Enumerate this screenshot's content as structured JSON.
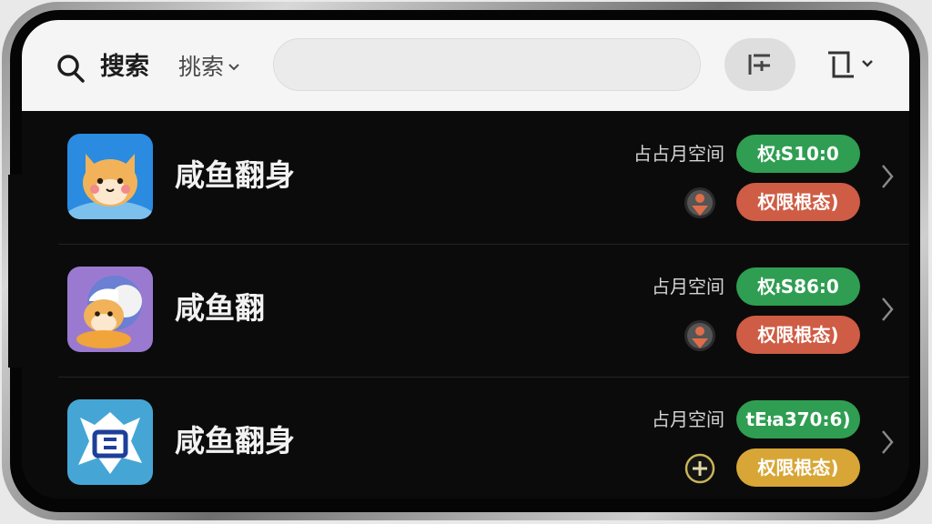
{
  "header": {
    "search_label": "搜索",
    "scope_label": "挑索",
    "search_placeholder": "",
    "search_value": "",
    "icons": {
      "search": "search-icon",
      "scope_dropdown": "chevron-down-icon",
      "filter": "filter-icon",
      "action": "crop-icon",
      "action_dropdown": "chevron-down-icon"
    }
  },
  "apps": [
    {
      "name": "咸鱼翻身",
      "space_label": "占占月空间",
      "primary_badge": "权ᵼS10:0",
      "secondary_badge": "权限根态)",
      "status_icon": "person-marker-icon",
      "icon": "fox-avatar-icon",
      "icon_bg": "#2a8be0",
      "secondary_color": "#cf5c44"
    },
    {
      "name": "咸鱼翻",
      "space_label": "占月空间",
      "primary_badge": "权ᵼS86:0",
      "secondary_badge": "权限根态)",
      "status_icon": "person-marker-icon",
      "icon": "chef-dog-icon",
      "icon_bg": "#9a7ad0",
      "secondary_color": "#cf5c44"
    },
    {
      "name": "咸鱼翻身",
      "space_label": "占月空间",
      "primary_badge": "tEᵼa370:6)",
      "secondary_badge": "权限根态)",
      "status_icon": "plus-circle-icon",
      "icon": "stamp-logo-icon",
      "icon_bg": "#45a6d6",
      "secondary_color": "#d8a636"
    }
  ],
  "colors": {
    "success": "#2f9e52",
    "danger": "#cf5c44",
    "warning": "#d8a636",
    "background": "#0b0b0b"
  }
}
